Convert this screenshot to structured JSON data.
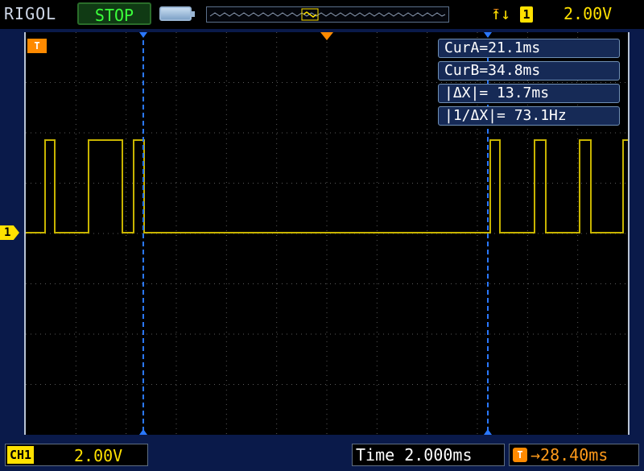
{
  "header": {
    "brand": "RIGOL",
    "run_state": "STOP",
    "trigger": {
      "slope_icon": "trigger-slope-icon",
      "channel": "1",
      "level": "2.00V"
    }
  },
  "markers": {
    "ch1": "1",
    "trigger": "T"
  },
  "cursors": {
    "cur_a": "CurA=21.1ms",
    "cur_b": "CurB=34.8ms",
    "delta_x": "|ΔX|= 13.7ms",
    "inv_delta_x": "|1/ΔX|= 73.1Hz"
  },
  "footer": {
    "ch1_label": "CH1",
    "ch1_scale": "2.00V",
    "timebase": "Time 2.000ms",
    "trigger_offset_icon": "T",
    "trigger_offset": "→28.40ms"
  },
  "colors": {
    "trace": "#c8b400",
    "cursor": "#2a78ff",
    "trigger": "#ff8a00",
    "frame": "#0a1a4a"
  }
}
